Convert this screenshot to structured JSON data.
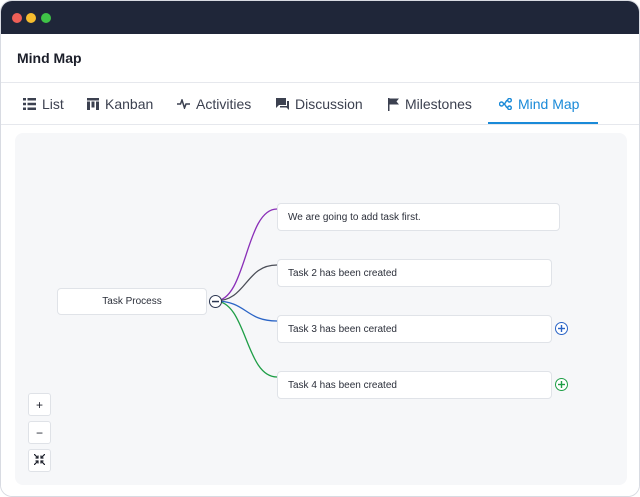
{
  "window": {
    "controls": [
      "close",
      "minimize",
      "maximize"
    ],
    "colors": {
      "close": "#ee5f57",
      "minimize": "#f6bd2e",
      "maximize": "#3fc347",
      "titlebar": "#1f2639"
    }
  },
  "header": {
    "title": "Mind Map"
  },
  "tabs": [
    {
      "label": "List",
      "icon": "list-icon",
      "active": false
    },
    {
      "label": "Kanban",
      "icon": "kanban-icon",
      "active": false
    },
    {
      "label": "Activities",
      "icon": "activity-icon",
      "active": false
    },
    {
      "label": "Discussion",
      "icon": "discussion-icon",
      "active": false
    },
    {
      "label": "Milestones",
      "icon": "flag-icon",
      "active": false
    },
    {
      "label": "Mind Map",
      "icon": "mindmap-icon",
      "active": true
    }
  ],
  "accent_color": "#1a8ad8",
  "mindmap": {
    "root": {
      "label": "Task Process",
      "expander": "collapse"
    },
    "children": [
      {
        "label": "We are going to add task first.",
        "branch_color": "#8a2fb8",
        "expander": null
      },
      {
        "label": "Task 2 has been created",
        "branch_color": "#4a4d57",
        "expander": null
      },
      {
        "label": "Task 3 has been cerated",
        "branch_color": "#2a64c6",
        "expander": "expand"
      },
      {
        "label": "Task 4 has been created",
        "branch_color": "#1e9e46",
        "expander": "expand"
      }
    ]
  },
  "zoom_controls": {
    "zoom_in": "+",
    "zoom_out": "−",
    "fit": "fit-screen-icon"
  }
}
